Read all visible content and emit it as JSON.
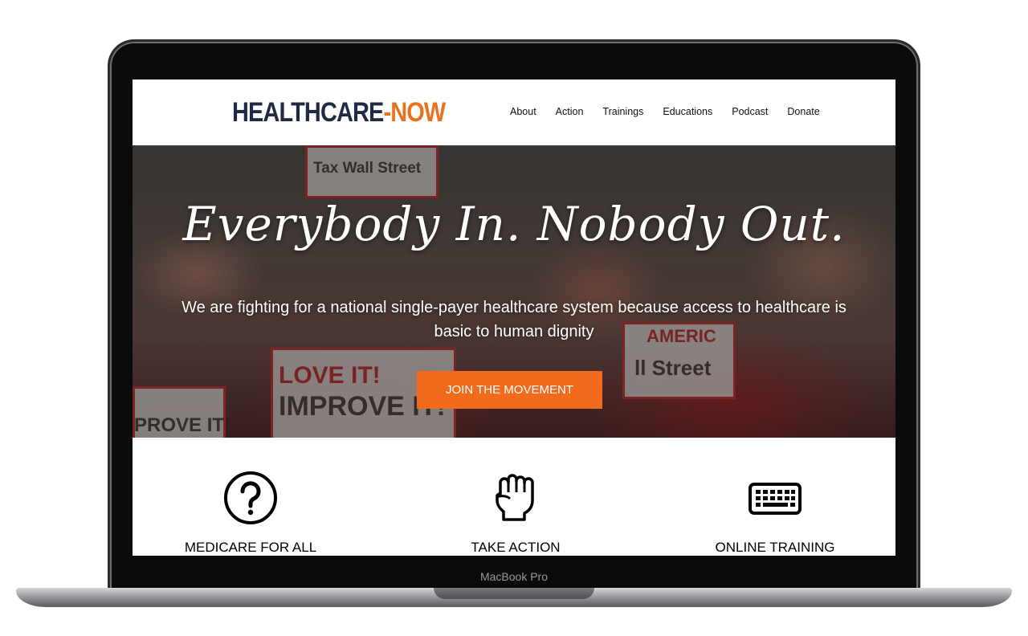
{
  "device": {
    "label": "MacBook Pro"
  },
  "header": {
    "logo_part_a": "HEALTHCARE",
    "logo_part_b": "-NOW",
    "nav": [
      "About",
      "Action",
      "Trainings",
      "Educations",
      "Podcast",
      "Donate"
    ]
  },
  "hero": {
    "title": "Everybody In. Nobody Out.",
    "subtitle": "We are fighting for a national single-payer healthcare system because access to healthcare is basic to human dignity",
    "cta": "JOIN THE MOVEMENT",
    "sign_texts": [
      "Tax Wall Street",
      "LOVE IT!",
      "IMPROVE IT!",
      "PROVE IT!",
      "ll Street",
      "AMERIC"
    ]
  },
  "features": [
    {
      "title": "MEDICARE FOR ALL",
      "icon": "question-circle-icon"
    },
    {
      "title": "TAKE ACTION",
      "icon": "raised-fist-icon"
    },
    {
      "title": "ONLINE TRAINING",
      "icon": "keyboard-icon"
    }
  ],
  "colors": {
    "brand_navy": "#1f2a44",
    "brand_orange": "#e8731c",
    "cta_orange": "#f26b1d"
  }
}
